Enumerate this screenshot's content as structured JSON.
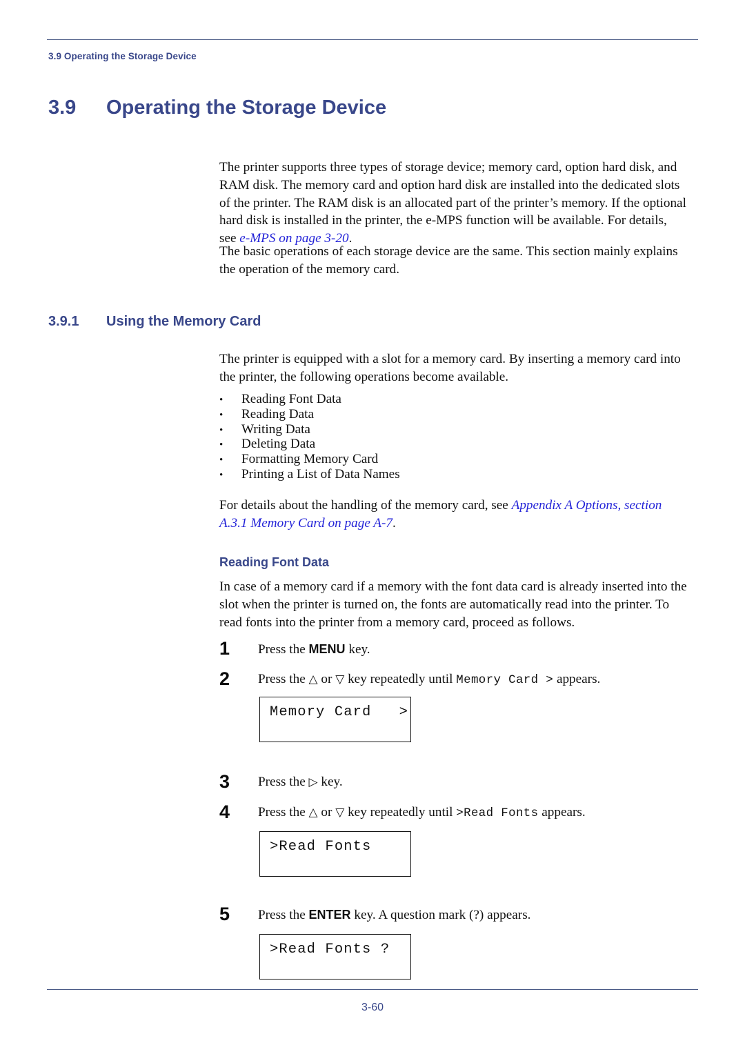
{
  "running_head": "3.9 Operating the Storage Device",
  "section": {
    "number": "3.9",
    "title": "Operating the Storage Device"
  },
  "intro": {
    "paragraph1_before_link": "The printer supports three types of storage device; memory card, option hard disk, and RAM disk. The memory card and option hard disk are installed into the dedicated slots of the printer. The RAM disk is an allocated part of the printer’s memory. If the optional hard disk is installed in the printer, the e-MPS function will be available. For details, see ",
    "paragraph1_link": "e-MPS on page 3-20",
    "paragraph1_after_link": ".",
    "paragraph2": "The basic operations of each storage device are the same. This section mainly explains the operation of the memory card."
  },
  "subsection": {
    "number": "3.9.1",
    "title": "Using the Memory Card",
    "paragraph": "The printer is equipped with a slot for a memory card. By inserting a memory card into the printer, the following operations become available.",
    "bullets": [
      {
        "marker": "•",
        "label": "Reading Font Data"
      },
      {
        "marker": "•",
        "label": "Reading Data"
      },
      {
        "marker": "•",
        "label": "Writing Data"
      },
      {
        "marker": "•",
        "label": "Deleting Data"
      },
      {
        "marker": "•",
        "label": "Formatting Memory Card"
      },
      {
        "marker": "•",
        "label": "Printing a List of Data Names"
      }
    ],
    "note_before_link": " For details about the handling of the memory card, see ",
    "note_link": "Appendix A Options, section A.3.1 Memory Card on page A-7",
    "note_after_link": "."
  },
  "reading_font_data": {
    "heading": "Reading Font Data",
    "paragraph": "In case of a memory card if a memory with the font data card is already inserted into the slot when the printer is turned on, the fonts are automatically read into the printer. To read fonts into the printer from a memory card, proceed as follows.",
    "steps": [
      {
        "number": "1",
        "text_before_key": "Press the ",
        "key": "MENU",
        "text_after_key": " key."
      },
      {
        "number": "2",
        "text_before_key": "Press the ",
        "up_arrow": "△",
        "or_text": " or ",
        "down_arrow": "▽",
        "text_middle": " key repeatedly until ",
        "display_ref": "Memory Card >",
        "text_after": " appears."
      },
      {
        "number": "3",
        "text_before_key": "Press the ",
        "right_arrow": "▷",
        "text_after_key": " key."
      },
      {
        "number": "4",
        "text_before_key": "Press the ",
        "up_arrow": "△",
        "or_text": " or ",
        "down_arrow": "▽",
        "text_middle": " key repeatedly until ",
        "display_ref": ">Read Fonts",
        "text_after": " appears."
      },
      {
        "number": "5",
        "text_before_key": "Press the ",
        "key": "ENTER",
        "text_after_key": " key. A question mark (?) appears."
      }
    ],
    "displays": [
      {
        "line": "Memory Card   >"
      },
      {
        "line": ">Read Fonts"
      },
      {
        "line": ">Read Fonts ?"
      }
    ]
  },
  "footer": {
    "page_number": "3-60"
  },
  "colors": {
    "heading_blue": "#39478a",
    "link_blue": "#2323d8",
    "rule_blue": "#4a5a86",
    "body_black": "#111111"
  }
}
